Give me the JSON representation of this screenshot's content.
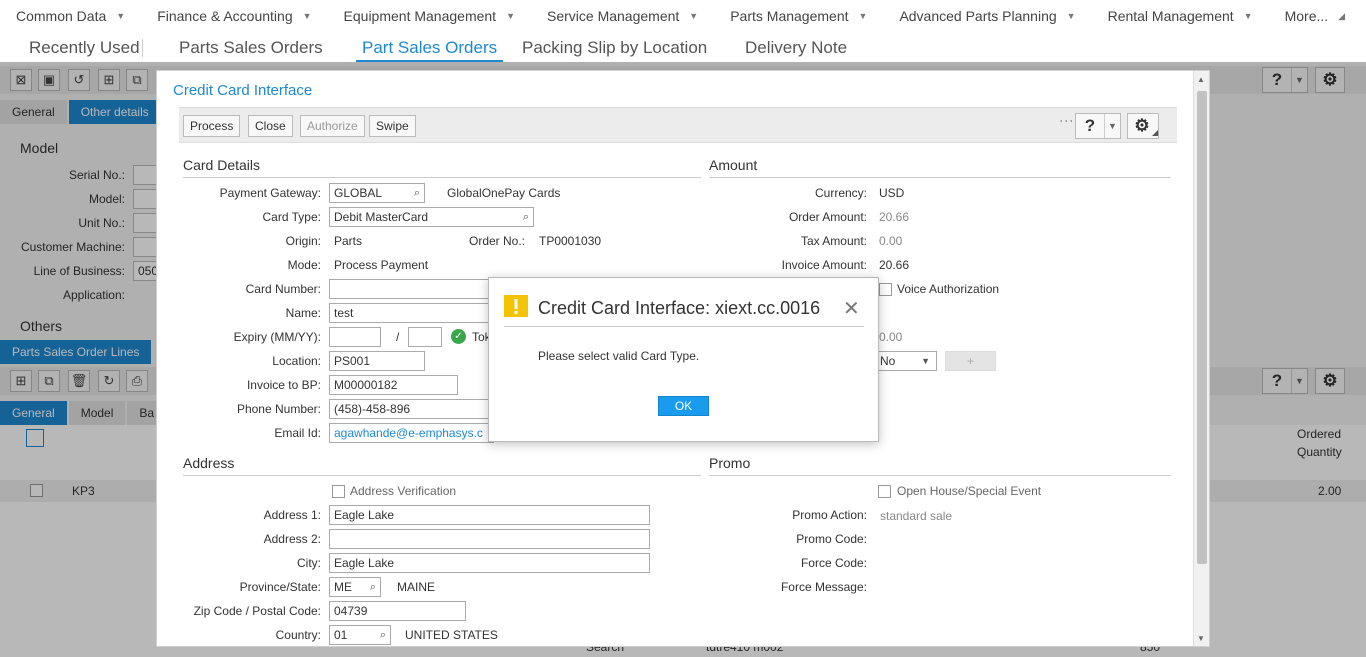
{
  "topmenu": {
    "items": [
      {
        "label": "Common Data"
      },
      {
        "label": "Finance & Accounting"
      },
      {
        "label": "Equipment Management"
      },
      {
        "label": "Service Management"
      },
      {
        "label": "Parts Management"
      },
      {
        "label": "Advanced Parts Planning"
      },
      {
        "label": "Rental Management"
      },
      {
        "label": "More..."
      }
    ]
  },
  "tabs": {
    "recent": "Recently Used",
    "t1": "Parts Sales Orders",
    "t2": "Part Sales Orders",
    "t3": "Packing Slip by Location",
    "t4": "Delivery Note"
  },
  "background": {
    "subtab_general": "General",
    "subtab_other": "Other details",
    "model_section": "Model",
    "labels": {
      "serial": "Serial No.:",
      "model": "Model:",
      "unit": "Unit No.:",
      "customer_machine": "Customer Machine:",
      "line_of_business": "Line of Business:",
      "application": "Application:"
    },
    "line_of_business_value": "050",
    "others_section": "Others",
    "lines_tab": "Parts Sales Order Lines",
    "lines_subtabs": {
      "general": "General",
      "model": "Model",
      "ba": "Ba"
    },
    "grid": {
      "col_ordered": "Ordered",
      "col_quantity": "Quantity",
      "row_item": "KP3",
      "row_qty": "2.00",
      "bottom_cell1": "Search",
      "bottom_cell2": "tdtre410 m002",
      "bottom_cell3": "850"
    }
  },
  "ccwindow": {
    "title": "Credit Card Interface",
    "buttons": {
      "process": "Process",
      "close": "Close",
      "authorize": "Authorize",
      "swipe": "Swipe"
    },
    "card_details": {
      "heading": "Card Details",
      "payment_gateway_label": "Payment Gateway:",
      "payment_gateway_value": "GLOBAL",
      "payment_gateway_desc": "GlobalOnePay Cards",
      "card_type_label": "Card Type:",
      "card_type_value": "Debit MasterCard",
      "origin_label": "Origin:",
      "origin_value": "Parts",
      "order_no_label": "Order No.:",
      "order_no_value": "TP0001030",
      "mode_label": "Mode:",
      "mode_value": "Process Payment",
      "card_number_label": "Card Number:",
      "name_label": "Name:",
      "name_value": "test",
      "expiry_label": "Expiry (MM/YY):",
      "expiry_sep": "/",
      "token_label": "Tok",
      "location_label": "Location:",
      "location_value": "PS001",
      "invoice_bp_label": "Invoice to BP:",
      "invoice_bp_value": "M00000182",
      "phone_label": "Phone Number:",
      "phone_value": "(458)-458-896",
      "email_label": "Email Id:",
      "email_value": "agawhande@e-emphasys.c"
    },
    "amount": {
      "heading": "Amount",
      "currency_label": "Currency:",
      "currency_value": "USD",
      "order_amount_label": "Order Amount:",
      "order_amount_value": "20.66",
      "tax_amount_label": "Tax Amount:",
      "tax_amount_value": "0.00",
      "invoice_amount_label": "Invoice Amount:",
      "invoice_amount_value": "20.66",
      "voice_auth_label": "Voice Authorization",
      "other_value": "0.00",
      "select_value": "No",
      "plus": "+"
    },
    "address": {
      "heading": "Address",
      "verification_label": "Address Verification",
      "address1_label": "Address 1:",
      "address1_value": "Eagle Lake",
      "address2_label": "Address 2:",
      "city_label": "City:",
      "city_value": "Eagle Lake",
      "province_label": "Province/State:",
      "province_value": "ME",
      "province_desc": "MAINE",
      "zip_label": "Zip Code / Postal Code:",
      "zip_value": "04739",
      "country_label": "Country:",
      "country_value": "01",
      "country_desc": "UNITED STATES"
    },
    "promo": {
      "heading": "Promo",
      "open_house_label": "Open House/Special Event",
      "promo_action_label": "Promo Action:",
      "promo_action_value": "standard sale",
      "promo_code_label": "Promo Code:",
      "force_code_label": "Force Code:",
      "force_message_label": "Force Message:"
    }
  },
  "alert": {
    "title": "Credit Card Interface: xiext.cc.0016",
    "message": "Please select valid Card Type.",
    "ok": "OK"
  },
  "colors": {
    "accent": "#1e88d0",
    "ok_button": "#1a9cee",
    "warning": "#f5c400",
    "token_ok": "#3aa64a"
  }
}
